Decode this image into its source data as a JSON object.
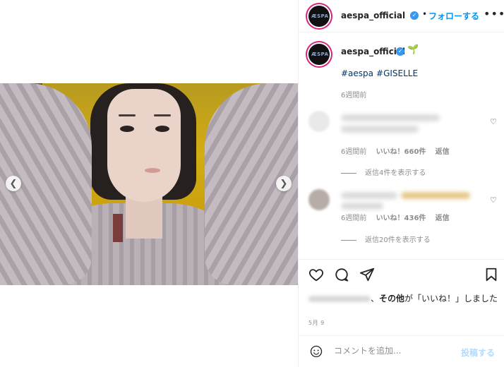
{
  "header": {
    "username": "aespa_official",
    "separator": "•",
    "follow_label": "フォローする",
    "more_label": "•••"
  },
  "caption": {
    "username": "aespa_official",
    "emoji": "🌱",
    "hashtags": [
      "#aespa",
      "#GISELLE"
    ],
    "time": "6週間前"
  },
  "comments": [
    {
      "time": "6週間前",
      "likes": "いいね！660件",
      "reply_label": "返信",
      "view_replies": "返信4件を表示する"
    },
    {
      "time": "6週間前",
      "likes": "いいね！436件",
      "reply_label": "返信",
      "view_replies": "返信20件を表示する"
    }
  ],
  "likes_line": {
    "separator": "、",
    "others": "その他",
    "suffix": "が「いいね！」しました"
  },
  "post_date": "5月 9",
  "comment_box": {
    "placeholder": "コメントを追加...",
    "post_label": "投稿する"
  },
  "icons": [
    "chevron-left-icon",
    "chevron-right-icon",
    "verified-icon",
    "heart-icon",
    "comment-icon",
    "share-icon",
    "bookmark-icon",
    "emoji-icon"
  ]
}
